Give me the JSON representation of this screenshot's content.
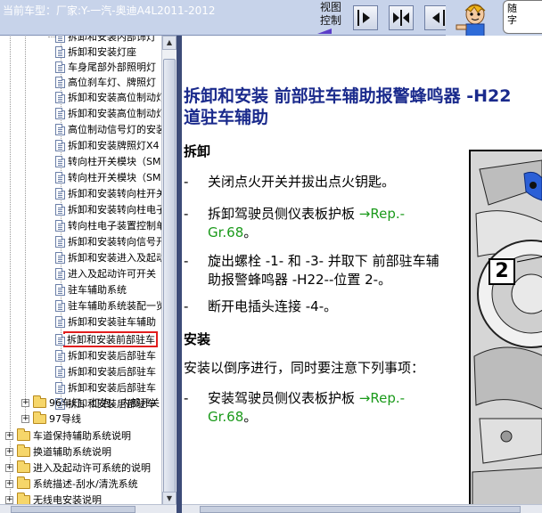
{
  "topbar": {
    "current_model": "当前车型：厂家:Y-一汽-奥迪A4L2011-2012",
    "view_control_label": "视图控制",
    "buttons": [
      "show-tree",
      "split-view",
      "show-document"
    ],
    "mascot_text": "随\n字"
  },
  "tree": {
    "items": [
      {
        "label": "拆卸和安装内部饰灯",
        "kind": "doc"
      },
      {
        "label": "拆卸和安装灯座",
        "kind": "doc"
      },
      {
        "label": "车身尾部外部照明灯",
        "kind": "doc"
      },
      {
        "label": "高位刹车灯、牌照灯",
        "kind": "doc"
      },
      {
        "label": "拆卸和安装高位制动灯",
        "kind": "doc"
      },
      {
        "label": "拆卸和安装高位制动灯",
        "kind": "doc"
      },
      {
        "label": "高位制动信号灯的安装",
        "kind": "doc"
      },
      {
        "label": "拆卸和安装牌照灯X4",
        "kind": "doc"
      },
      {
        "label": "转向柱开关模块（SM",
        "kind": "doc"
      },
      {
        "label": "转向柱开关模块（SM",
        "kind": "doc"
      },
      {
        "label": "拆卸和安装转向柱开关",
        "kind": "doc"
      },
      {
        "label": "拆卸和安装转向柱电子",
        "kind": "doc"
      },
      {
        "label": "转向柱电子装置控制单元",
        "kind": "doc"
      },
      {
        "label": "拆卸和安装转向信号开关",
        "kind": "doc"
      },
      {
        "label": "拆卸和安装进入及起动",
        "kind": "doc"
      },
      {
        "label": "进入及起动许可开关",
        "kind": "doc"
      },
      {
        "label": "驻车辅助系统",
        "kind": "doc"
      },
      {
        "label": "驻车辅助系统装配一览",
        "kind": "doc"
      },
      {
        "label": "拆卸和安装驻车辅助",
        "kind": "doc"
      },
      {
        "label": "拆卸和安装前部驻车",
        "kind": "doc",
        "selected": true
      },
      {
        "label": "拆卸和安装后部驻车",
        "kind": "doc"
      },
      {
        "label": "拆卸和安装后部驻车",
        "kind": "doc"
      },
      {
        "label": "拆卸和安装后部驻车",
        "kind": "doc"
      },
      {
        "label": "拆卸和安装后部驻车",
        "kind": "doc"
      },
      {
        "label": "96车灯，灯泡，内部开关",
        "kind": "folder",
        "level": 1
      },
      {
        "label": "97导线",
        "kind": "folder",
        "level": 1
      },
      {
        "label": "车道保持辅助系统说明",
        "kind": "folder",
        "level": 0
      },
      {
        "label": "换道辅助系统说明",
        "kind": "folder",
        "level": 0
      },
      {
        "label": "进入及起动许可系统的说明",
        "kind": "folder",
        "level": 0
      },
      {
        "label": "系统描述-刮水/清洗系统",
        "kind": "folder",
        "level": 0
      },
      {
        "label": "无线电安装说明",
        "kind": "folder",
        "level": 0
      }
    ]
  },
  "document": {
    "title_line1": "拆卸和安装 前部驻车辅助报警蜂鸣器 -H22",
    "title_line2": "道驻车辅助",
    "removal_heading": "拆卸",
    "removal_steps": [
      {
        "text": "关闭点火开关并拔出点火钥匙。"
      },
      {
        "text": "拆卸驾驶员侧仪表板护板 ",
        "link": "→Rep.-Gr.68",
        "after": "。"
      },
      {
        "text": "旋出螺栓 -1- 和 -3- 并取下 前部驻车辅助报警蜂鸣器 -H22--位置 2-。"
      },
      {
        "text": "断开电插头连接 -4-。"
      }
    ],
    "install_heading": "安装",
    "install_intro": "安装以倒序进行，同时要注意下列事项：",
    "install_steps": [
      {
        "text": "安装驾驶员侧仪表板护板 ",
        "link": "→Rep.-Gr.68",
        "after": "。"
      }
    ],
    "figure_callout": "2"
  },
  "colors": {
    "title": "#1a2a8c",
    "link": "#1b9a1b",
    "topbar": "#c7d3ea",
    "splitter": "#3d4c78",
    "selection_border": "#e11d1d"
  }
}
